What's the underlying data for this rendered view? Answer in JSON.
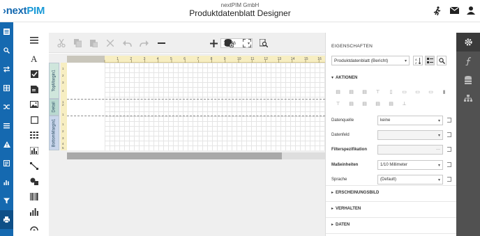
{
  "header": {
    "logo_prefix": "›next",
    "logo_suffix": "PIM",
    "company": "nextPIM GmbH",
    "title": "Produktdatenblatt Designer",
    "icons": [
      "run-icon",
      "mail-icon",
      "user-icon"
    ]
  },
  "sidebar": {
    "icons": [
      "list-icon",
      "search-icon",
      "swap-icon",
      "table-icon",
      "shuffle-icon",
      "menu-icon",
      "warning-icon",
      "document-icon",
      "bar-chart-icon",
      "filter-icon",
      "print-icon"
    ],
    "active": 10
  },
  "tools": {
    "icons": [
      "hamburger-icon",
      "text-icon",
      "checkbox-icon",
      "rich-text-icon",
      "picture-icon",
      "shape-icon",
      "table-icon",
      "chart-icon",
      "line-icon",
      "shapes-icon",
      "barcode-icon",
      "bar-chart-icon",
      "gauge-icon"
    ]
  },
  "toolbar": {
    "zoom": "100%"
  },
  "ruler": {
    "labels": [
      "1",
      "2",
      "3",
      "4",
      "5",
      "6",
      "7",
      "8",
      "9",
      "10",
      "11",
      "12",
      "13",
      "14",
      "15",
      "16"
    ]
  },
  "vruler": {
    "labels": [
      "1",
      "2",
      "3",
      "4",
      "1",
      "2",
      "1",
      "1",
      "2",
      "3",
      "4",
      "5"
    ]
  },
  "bands": {
    "top": "TopMargin1",
    "detail": "Detail",
    "bottom": "BottomMargin1"
  },
  "properties": {
    "heading": "EIGENSCHAFTEN",
    "selected": "Produktdatenblatt (Bericht)",
    "sections": {
      "actions": "AKTIONEN",
      "appearance": "ERSCHEINUNGSBILD",
      "behavior": "VERHALTEN",
      "data": "DATEN"
    },
    "rows": [
      {
        "label": "Datenquelle",
        "value": "keine",
        "bold": false,
        "disabled": false,
        "caret": true,
        "dots": false
      },
      {
        "label": "Datenfeld",
        "value": "",
        "bold": false,
        "disabled": true,
        "caret": true,
        "dots": false
      },
      {
        "label": "Filterspezifikation",
        "value": "",
        "bold": true,
        "disabled": true,
        "caret": false,
        "dots": true
      },
      {
        "label": "Maßeinheiten",
        "value": "1/10 Millimeter",
        "bold": true,
        "disabled": false,
        "caret": true,
        "dots": false
      },
      {
        "label": "Sprache",
        "value": "(Default)",
        "bold": false,
        "disabled": false,
        "caret": true,
        "dots": false
      }
    ]
  },
  "right_strip": {
    "icons": [
      "gear-icon",
      "function-icon",
      "database-icon",
      "sitemap-icon"
    ],
    "active": 0
  },
  "colors": {
    "nav": "#1569b0",
    "ruler": "#f7eec2",
    "strip": "#515151"
  }
}
